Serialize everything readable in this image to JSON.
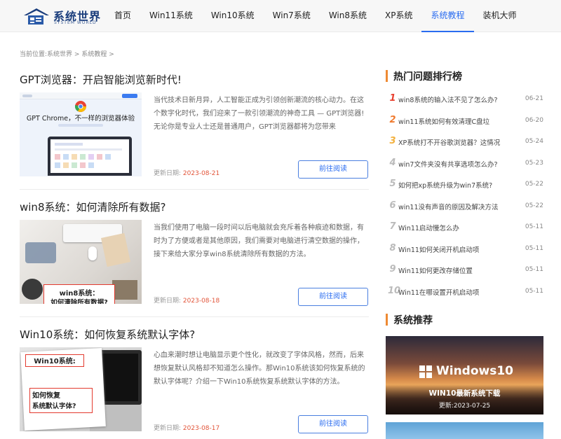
{
  "header": {
    "logo_title": "系统世界",
    "logo_sub": "SYSTEM WORLD",
    "nav": [
      {
        "label": "首页",
        "active": false
      },
      {
        "label": "Win11系统",
        "active": false
      },
      {
        "label": "Win10系统",
        "active": false
      },
      {
        "label": "Win7系统",
        "active": false
      },
      {
        "label": "Win8系统",
        "active": false
      },
      {
        "label": "XP系统",
        "active": false
      },
      {
        "label": "系统教程",
        "active": true
      },
      {
        "label": "装机大师",
        "active": false
      }
    ]
  },
  "breadcrumb": {
    "prefix": "当前位置:",
    "items": [
      "系统世界",
      "系统教程"
    ],
    "sep": " > "
  },
  "articles": [
    {
      "title": "GPT浏览器：开启智能浏览新时代!",
      "desc": "当代技术日新月异，人工智能正成为引领创新潮流的核心动力。在这个数字化时代，我们迎来了一款引领潮流的神奇工具 — GPT浏览器!无论你是专业人士还是普通用户，GPT浏览器都将为您带来",
      "date_label": "更新日期:",
      "date": "2023-08-21",
      "button": "前往阅读",
      "thumb_text": "GPT Chrome，不一样的浏览器体验"
    },
    {
      "title": "win8系统：如何清除所有数据?",
      "desc": "当我们使用了电脑一段时间以后电脑就会充斥着各种痕迹和数据，有时为了方便或者是其他原因，我们需要对电脑进行清空数据的操作，接下来给大家分享win8系统清除所有数据的方法。",
      "date_label": "更新日期:",
      "date": "2023-08-18",
      "button": "前往阅读",
      "thumb_text_1": "win8系统：",
      "thumb_text_2": "如何清除所有数据?"
    },
    {
      "title": "Win10系统：如何恢复系统默认字体?",
      "desc": "心血来潮时想让电脑显示更个性化，就改变了字体风格，然而，后来想恢复默认风格却不知道怎么操作。那Win10系统该如何恢复系统的默认字体呢？介绍一下Win10系统恢复系统默认字体的方法。",
      "date_label": "更新日期:",
      "date": "2023-08-17",
      "button": "前往阅读",
      "thumb_text_1": "Win10系统:",
      "thumb_text_2": "如何恢复",
      "thumb_text_3": "系统默认字体?"
    }
  ],
  "sidebar": {
    "hot_title": "热门问题排行榜",
    "hot": [
      {
        "num": "1",
        "title": "win8系统的输入法不见了怎么办?",
        "date": "06-21"
      },
      {
        "num": "2",
        "title": "win11系统如何有效清理C盘垃",
        "date": "06-20"
      },
      {
        "num": "3",
        "title": "XP系统打不开谷歌浏览器？这情况",
        "date": "05-24"
      },
      {
        "num": "4",
        "title": "win7文件夹没有共享选项怎么办?",
        "date": "05-23"
      },
      {
        "num": "5",
        "title": "如何把xp系统升级为win7系统?",
        "date": "05-22"
      },
      {
        "num": "6",
        "title": "win11没有声音的原因及解决方法",
        "date": "05-22"
      },
      {
        "num": "7",
        "title": "Win11启动慢怎么办",
        "date": "05-11"
      },
      {
        "num": "8",
        "title": "Win11如何关闭开机启动项",
        "date": "05-11"
      },
      {
        "num": "9",
        "title": "Win11如何更改存储位置",
        "date": "05-11"
      },
      {
        "num": "10",
        "title": "Win11在哪设置开机启动项",
        "date": "05-11"
      }
    ],
    "rec_title": "系统推荐",
    "banner": {
      "brand": "Windows10",
      "caption": "WIN10最新系统下载",
      "date_label": "更新:",
      "date": "2023-07-25"
    }
  },
  "colors": {
    "accent": "#2a6cf0",
    "orange": "#ee8a33",
    "date_red": "#e2553a"
  }
}
